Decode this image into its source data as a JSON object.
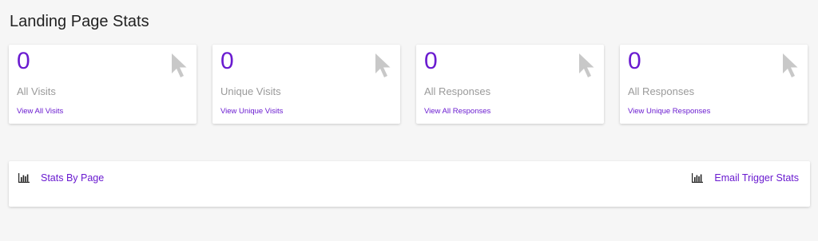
{
  "page": {
    "title": "Landing Page Stats"
  },
  "cards": [
    {
      "value": "0",
      "label": "All Visits",
      "link": "View All Visits",
      "icon": "cursor-icon"
    },
    {
      "value": "0",
      "label": "Unique Visits",
      "link": "View Unique Visits",
      "icon": "cursor-icon"
    },
    {
      "value": "0",
      "label": "All Responses",
      "link": "View All Responses",
      "icon": "cursor-icon"
    },
    {
      "value": "0",
      "label": "All Responses",
      "link": "View Unique Responses",
      "icon": "cursor-icon"
    }
  ],
  "bottom_panel": {
    "left_link": {
      "label": "Stats By Page",
      "icon": "bar-chart-icon"
    },
    "right_link": {
      "label": "Email Trigger Stats",
      "icon": "bar-chart-icon"
    }
  },
  "colors": {
    "accent": "#6a1bd0",
    "muted_text": "#9a9a9a",
    "icon_gray": "#c8c8c8",
    "background": "#f6f6f6"
  }
}
